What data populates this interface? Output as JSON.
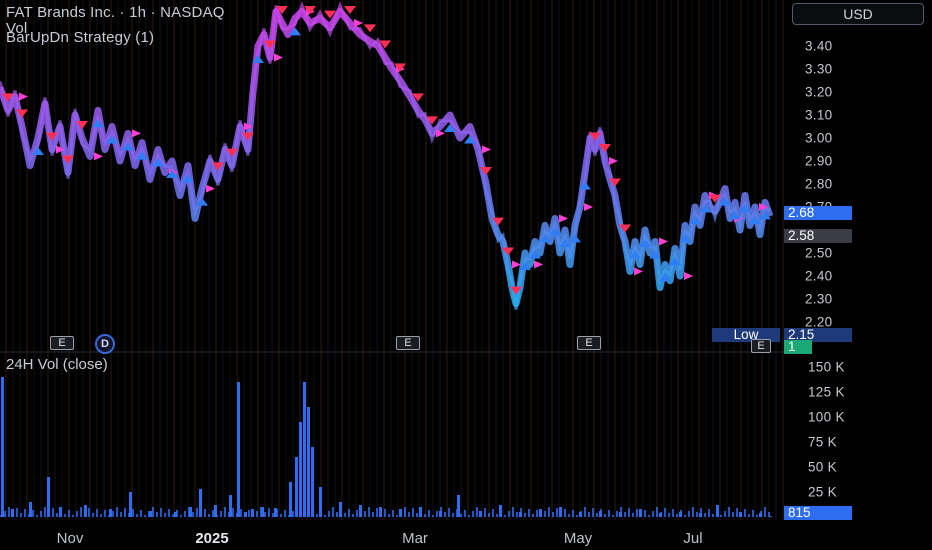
{
  "header": {
    "symbol_line": "FAT Brands Inc. · 1h · NASDAQ",
    "vol_label": "Vol",
    "strategy_label": "BarUpDn Strategy (1)",
    "currency": "USD"
  },
  "volume_pane": {
    "title": "24H Vol (close)",
    "y_ticks": [
      "150 K",
      "125 K",
      "100 K",
      "75 K",
      "50 K",
      "25 K"
    ],
    "last_value": "815"
  },
  "price_tags": {
    "last_price": "2.68",
    "crosshair_price": "2.58",
    "low_label": "Low",
    "low_value": "2.15",
    "volume_overlay_value": "1"
  },
  "markers": {
    "earnings": "E",
    "dividend": "D"
  },
  "colors": {
    "background": "#000000",
    "line_high": "#c04cf0",
    "line_low": "#2ea6f2",
    "up_arrow": "#2f7df5",
    "down_arrow": "#ff2e55",
    "magenta_marker": "#ff3fd0",
    "volume_bars": "#2f6df0",
    "last_price_tag": "#2f6df0",
    "crosshair_tag": "#3a3d45",
    "low_tag": "#1e3a7a",
    "green_tag": "#1aa877"
  },
  "chart_data": [
    {
      "type": "line",
      "title": "FAT Brands Inc. · 1h · NASDAQ",
      "x_ticks": [
        "Nov",
        "2025",
        "Mar",
        "May",
        "Jul"
      ],
      "y_ticks": [
        "3.40",
        "3.30",
        "3.20",
        "3.10",
        "3.00",
        "2.90",
        "2.80",
        "2.70",
        "2.50",
        "2.40",
        "2.30",
        "2.20"
      ],
      "ylim": [
        2.13,
        3.57
      ],
      "grid": false,
      "series": [
        {
          "name": "FAT Brands Inc. · 1h · NASDAQ",
          "x": [
            0,
            8,
            15,
            22,
            30,
            38,
            45,
            52,
            60,
            68,
            75,
            82,
            90,
            98,
            105,
            112,
            120,
            128,
            135,
            142,
            150,
            158,
            165,
            172,
            180,
            188,
            195,
            202,
            210,
            218,
            225,
            232,
            240,
            248,
            253,
            258,
            264,
            270,
            276,
            282,
            288,
            295,
            302,
            310,
            320,
            330,
            340,
            350,
            360,
            370,
            378,
            385,
            392,
            400,
            410,
            418,
            425,
            432,
            440,
            450,
            460,
            470,
            478,
            486,
            492,
            498,
            503,
            508,
            512,
            516,
            520,
            525,
            530,
            535,
            540,
            545,
            550,
            555,
            560,
            565,
            570,
            575,
            580,
            585,
            590,
            595,
            600,
            605,
            610,
            615,
            620,
            625,
            630,
            635,
            640,
            645,
            650,
            655,
            660,
            665,
            670,
            675,
            680,
            685,
            690,
            695,
            700,
            705,
            710,
            715,
            720,
            725,
            730,
            735,
            740,
            745,
            750,
            755,
            760,
            765,
            770
          ],
          "values": [
            3.22,
            3.12,
            3.18,
            3.05,
            2.88,
            3.0,
            3.15,
            2.95,
            3.05,
            2.85,
            3.1,
            3.0,
            2.92,
            3.12,
            2.95,
            3.05,
            2.9,
            3.02,
            2.88,
            2.98,
            2.82,
            2.95,
            2.85,
            2.9,
            2.75,
            2.88,
            2.65,
            2.78,
            2.9,
            2.82,
            2.95,
            2.88,
            3.05,
            2.95,
            3.2,
            3.4,
            3.45,
            3.35,
            3.55,
            3.5,
            3.45,
            3.52,
            3.55,
            3.5,
            3.52,
            3.48,
            3.55,
            3.5,
            3.45,
            3.42,
            3.4,
            3.35,
            3.3,
            3.25,
            3.18,
            3.12,
            3.08,
            3.02,
            3.05,
            3.1,
            3.0,
            3.05,
            2.95,
            2.8,
            2.65,
            2.58,
            2.55,
            2.45,
            2.35,
            2.28,
            2.35,
            2.5,
            2.45,
            2.55,
            2.5,
            2.62,
            2.55,
            2.65,
            2.5,
            2.6,
            2.45,
            2.62,
            2.7,
            2.85,
            3.0,
            2.95,
            3.02,
            2.9,
            2.82,
            2.75,
            2.62,
            2.55,
            2.42,
            2.55,
            2.45,
            2.6,
            2.5,
            2.55,
            2.35,
            2.45,
            2.38,
            2.52,
            2.4,
            2.62,
            2.55,
            2.7,
            2.62,
            2.75,
            2.7,
            2.68,
            2.72,
            2.78,
            2.65,
            2.72,
            2.6,
            2.75,
            2.62,
            2.7,
            2.58,
            2.72,
            2.66
          ]
        }
      ]
    },
    {
      "type": "bar",
      "title": "24H Vol (close)",
      "y_ticks": [
        "150 K",
        "125 K",
        "100 K",
        "75 K",
        "50 K",
        "25 K"
      ],
      "ylim": [
        0,
        158000
      ],
      "grid": false,
      "series": [
        {
          "name": "24H Vol (close)",
          "x": [
            2,
            12,
            30,
            48,
            60,
            85,
            110,
            130,
            150,
            175,
            190,
            200,
            215,
            230,
            238,
            245,
            252,
            262,
            275,
            290,
            296,
            300,
            304,
            308,
            312,
            320,
            340,
            360,
            380,
            400,
            420,
            440,
            458,
            480,
            500,
            520,
            540,
            560,
            580,
            600,
            620,
            640,
            660,
            680,
            700,
            717,
            740,
            760,
            770
          ],
          "values": [
            140000,
            8000,
            15000,
            40000,
            10000,
            12000,
            8000,
            25000,
            6000,
            5000,
            10000,
            28000,
            12000,
            22000,
            135000,
            5000,
            8000,
            10000,
            9000,
            35000,
            60000,
            95000,
            135000,
            110000,
            70000,
            30000,
            15000,
            12000,
            10000,
            8000,
            10000,
            6000,
            22000,
            6000,
            12000,
            5000,
            8000,
            10000,
            5000,
            6000,
            5000,
            8000,
            4000,
            5000,
            4000,
            12000,
            5000,
            4000,
            815
          ]
        }
      ]
    }
  ]
}
